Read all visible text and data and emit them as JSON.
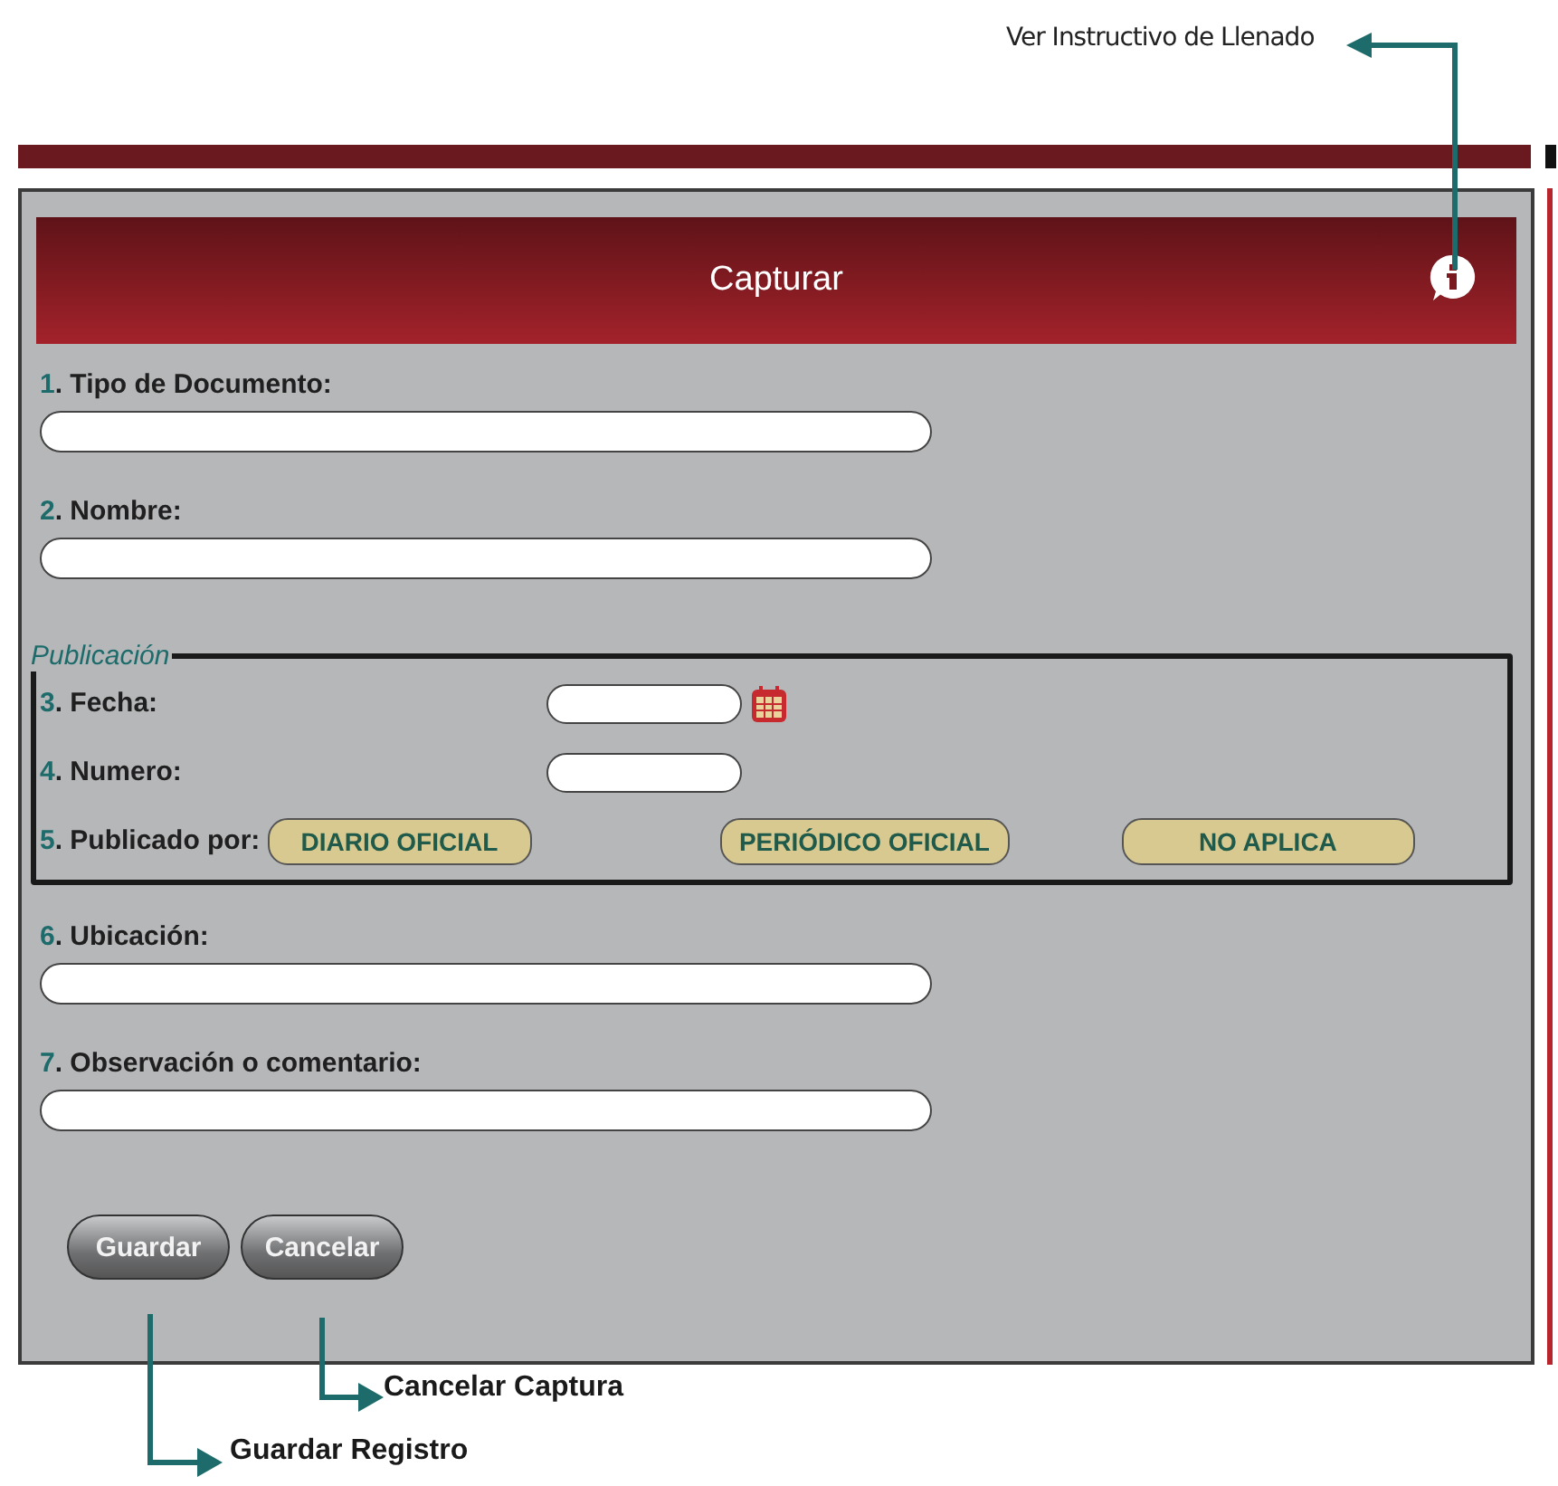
{
  "callouts": {
    "help": "Ver Instructivo de Llenado",
    "save": "Guardar Registro",
    "cancel": "Cancelar Captura"
  },
  "form": {
    "title": "Capturar",
    "top_fields": [
      {
        "num": "1",
        "label": ". Tipo de Documento:"
      },
      {
        "num": "2",
        "label": ". Nombre:"
      }
    ],
    "publication": {
      "legend": "Publicación",
      "date": {
        "num": "3",
        "label": ". Fecha:"
      },
      "number": {
        "num": "4",
        "label": ". Numero:"
      },
      "published_by": {
        "num": "5",
        "label": ". Publicado por:",
        "options": [
          "DIARIO OFICIAL",
          "PERIÓDICO OFICIAL",
          "NO APLICA"
        ]
      }
    },
    "bottom_fields": [
      {
        "num": "6",
        "label": ". Ubicación:"
      },
      {
        "num": "7",
        "label": ". Observación o comentario:"
      }
    ],
    "buttons": [
      "Guardar",
      "Cancelar"
    ]
  }
}
